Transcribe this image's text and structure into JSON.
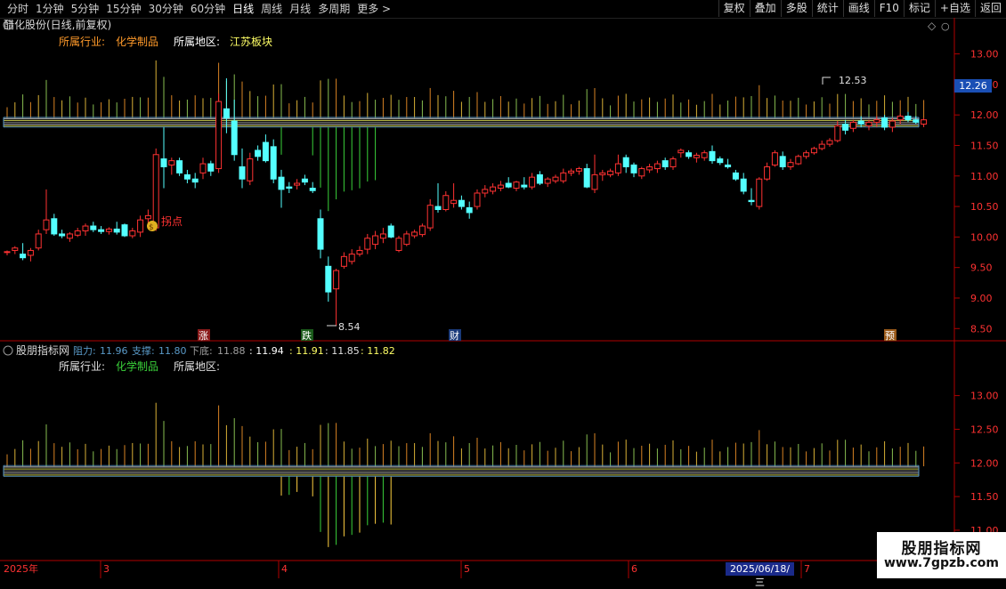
{
  "toolbar": {
    "periods": [
      "分时",
      "1分钟",
      "5分钟",
      "15分钟",
      "30分钟",
      "60分钟",
      "日线",
      "周线",
      "月线",
      "多周期",
      "更多"
    ],
    "active_period": "日线",
    "more_glyph": ">",
    "right_buttons": [
      "复权",
      "叠加",
      "多股",
      "统计",
      "画线",
      "F10",
      "标记",
      "+自选",
      "返回"
    ]
  },
  "main_panel": {
    "title": "醋化股份(日线,前复权)",
    "industry_label": "所属行业:",
    "industry_value": "化学制品",
    "region_label": "所属地区:",
    "region_value": "江苏板块",
    "pivot_label": "拐点",
    "high_label": "12.53",
    "low_label": "8.54",
    "current_price": "12.26",
    "event_markers": [
      "涨",
      "跌",
      "财",
      "预"
    ],
    "icons": [
      "dropdown-icon",
      "diamond-icon",
      "circle-icon"
    ]
  },
  "sub_panel": {
    "title": "股朋指标网",
    "resistance_label": "阻力:",
    "resistance_value": "11.96",
    "support_label": "支撑:",
    "support_value": "11.80",
    "bottom_label": "下底:",
    "bottom_value": "11.88",
    "v2": ": 11.94",
    "v3": ": 11.91",
    "v4": ": 11.85",
    "v5": ": 11.82",
    "industry_label": "所属行业:",
    "industry_value": "化学制品",
    "region_label": "所属地区:"
  },
  "x_axis": {
    "labels": [
      "2025年",
      "3",
      "4",
      "5",
      "6",
      "7"
    ],
    "highlight_date": "2025/06/18/三"
  },
  "watermark": {
    "line1": "股朋指标网",
    "line2": "www.7gpzb.com"
  },
  "colors": {
    "up": "#ff3232",
    "down": "#54ffff",
    "axis": "#b00000",
    "band": "#7aa0c0",
    "orange": "#ff9a2a",
    "green": "#3ad23a",
    "yellow": "#ffff66"
  },
  "chart_data": [
    {
      "type": "candlestick",
      "title": "醋化股份(日线,前复权)",
      "ylim": [
        8.3,
        13.3
      ],
      "yticks": [
        8.5,
        9.0,
        9.5,
        10.0,
        10.5,
        11.0,
        11.5,
        12.0,
        12.5,
        13.0
      ],
      "annotations": [
        {
          "text": "12.53",
          "value": 12.53
        },
        {
          "text": "8.54",
          "value": 8.54
        },
        {
          "text": "拐点"
        }
      ],
      "ohlc": [
        [
          9.75,
          9.78,
          9.7,
          9.76
        ],
        [
          9.78,
          9.85,
          9.72,
          9.82
        ],
        [
          9.72,
          9.9,
          9.62,
          9.66
        ],
        [
          9.7,
          9.82,
          9.6,
          9.78
        ],
        [
          9.82,
          10.12,
          9.78,
          10.05
        ],
        [
          10.12,
          10.78,
          10.05,
          10.28
        ],
        [
          10.3,
          10.38,
          10.02,
          10.05
        ],
        [
          10.05,
          10.12,
          9.98,
          10.02
        ],
        [
          9.98,
          10.08,
          9.92,
          10.05
        ],
        [
          10.03,
          10.15,
          10.0,
          10.1
        ],
        [
          10.1,
          10.22,
          10.02,
          10.18
        ],
        [
          10.18,
          10.25,
          10.08,
          10.12
        ],
        [
          10.12,
          10.18,
          10.05,
          10.09
        ],
        [
          10.09,
          10.16,
          10.04,
          10.13
        ],
        [
          10.13,
          10.25,
          10.04,
          10.08
        ],
        [
          10.2,
          10.22,
          10.0,
          10.02
        ],
        [
          10.02,
          10.15,
          9.98,
          10.1
        ],
        [
          10.08,
          10.35,
          10.0,
          10.28
        ],
        [
          10.3,
          10.45,
          10.22,
          10.35
        ],
        [
          10.15,
          11.45,
          10.1,
          11.35
        ],
        [
          11.28,
          11.8,
          10.8,
          11.15
        ],
        [
          11.18,
          11.3,
          11.02,
          11.25
        ],
        [
          11.25,
          11.3,
          11.0,
          11.05
        ],
        [
          11.02,
          11.1,
          10.88,
          10.95
        ],
        [
          10.95,
          11.05,
          10.8,
          10.9
        ],
        [
          11.05,
          11.3,
          10.95,
          11.2
        ],
        [
          11.2,
          11.25,
          11.0,
          11.08
        ],
        [
          11.12,
          12.35,
          11.05,
          12.22
        ],
        [
          12.1,
          12.6,
          11.7,
          11.95
        ],
        [
          11.9,
          12.25,
          11.25,
          11.35
        ],
        [
          11.15,
          11.45,
          10.8,
          10.95
        ],
        [
          10.92,
          11.38,
          10.85,
          11.28
        ],
        [
          11.42,
          11.5,
          11.25,
          11.32
        ],
        [
          11.55,
          11.68,
          11.22,
          11.25
        ],
        [
          11.48,
          11.6,
          10.88,
          10.95
        ],
        [
          10.98,
          11.1,
          10.48,
          10.78
        ],
        [
          10.82,
          10.9,
          10.72,
          10.8
        ],
        [
          10.85,
          10.95,
          10.78,
          10.88
        ],
        [
          10.95,
          11.02,
          10.85,
          10.9
        ],
        [
          10.8,
          10.9,
          10.72,
          10.76
        ],
        [
          10.3,
          10.45,
          9.65,
          9.8
        ],
        [
          9.52,
          9.68,
          8.94,
          9.1
        ],
        [
          9.15,
          9.48,
          8.54,
          9.45
        ],
        [
          9.52,
          9.75,
          9.48,
          9.68
        ],
        [
          9.6,
          9.8,
          9.55,
          9.72
        ],
        [
          9.72,
          9.85,
          9.68,
          9.78
        ],
        [
          9.8,
          10.05,
          9.72,
          9.98
        ],
        [
          9.88,
          10.1,
          9.8,
          10.02
        ],
        [
          9.98,
          10.15,
          9.9,
          10.05
        ],
        [
          10.18,
          10.22,
          9.98,
          10.0
        ],
        [
          9.78,
          10.02,
          9.75,
          9.98
        ],
        [
          9.88,
          10.1,
          9.85,
          10.05
        ],
        [
          10.02,
          10.12,
          9.98,
          10.08
        ],
        [
          10.04,
          10.22,
          10.0,
          10.18
        ],
        [
          10.15,
          10.62,
          10.1,
          10.52
        ],
        [
          10.5,
          10.88,
          10.4,
          10.45
        ],
        [
          10.45,
          10.75,
          10.42,
          10.68
        ],
        [
          10.55,
          10.88,
          10.48,
          10.6
        ],
        [
          10.6,
          10.68,
          10.45,
          10.5
        ],
        [
          10.48,
          10.58,
          10.3,
          10.4
        ],
        [
          10.5,
          10.78,
          10.45,
          10.72
        ],
        [
          10.72,
          10.85,
          10.65,
          10.78
        ],
        [
          10.75,
          10.88,
          10.7,
          10.82
        ],
        [
          10.8,
          10.92,
          10.75,
          10.85
        ],
        [
          10.88,
          10.98,
          10.8,
          10.82
        ],
        [
          10.8,
          10.92,
          10.75,
          10.9
        ],
        [
          10.85,
          10.98,
          10.78,
          10.82
        ],
        [
          10.82,
          11.05,
          10.78,
          10.98
        ],
        [
          11.02,
          11.08,
          10.85,
          10.88
        ],
        [
          10.88,
          10.98,
          10.82,
          10.95
        ],
        [
          10.92,
          11.02,
          10.88,
          10.98
        ],
        [
          10.92,
          11.12,
          10.88,
          11.05
        ],
        [
          11.05,
          11.12,
          11.0,
          11.08
        ],
        [
          11.08,
          11.15,
          11.02,
          11.12
        ],
        [
          11.12,
          11.2,
          10.8,
          10.82
        ],
        [
          10.78,
          11.35,
          10.72,
          11.02
        ],
        [
          11.02,
          11.1,
          10.92,
          11.05
        ],
        [
          11.02,
          11.12,
          10.98,
          11.08
        ],
        [
          11.05,
          11.35,
          11.0,
          11.2
        ],
        [
          11.3,
          11.35,
          11.05,
          11.15
        ],
        [
          11.18,
          11.22,
          10.98,
          11.05
        ],
        [
          11.0,
          11.15,
          10.95,
          11.12
        ],
        [
          11.1,
          11.2,
          11.05,
          11.15
        ],
        [
          11.12,
          11.25,
          11.05,
          11.2
        ],
        [
          11.25,
          11.3,
          11.1,
          11.15
        ],
        [
          11.15,
          11.32,
          11.1,
          11.28
        ],
        [
          11.38,
          11.45,
          11.3,
          11.42
        ],
        [
          11.38,
          11.42,
          11.28,
          11.32
        ],
        [
          11.3,
          11.38,
          11.22,
          11.34
        ],
        [
          11.3,
          11.42,
          11.25,
          11.38
        ],
        [
          11.4,
          11.5,
          11.2,
          11.25
        ],
        [
          11.28,
          11.32,
          11.18,
          11.22
        ],
        [
          11.18,
          11.28,
          11.12,
          11.15
        ],
        [
          11.05,
          11.1,
          10.92,
          10.95
        ],
        [
          10.95,
          11.05,
          10.7,
          10.75
        ],
        [
          10.6,
          10.8,
          10.52,
          10.58
        ],
        [
          10.5,
          10.98,
          10.45,
          10.95
        ],
        [
          10.95,
          11.22,
          10.92,
          11.15
        ],
        [
          11.18,
          11.42,
          11.15,
          11.38
        ],
        [
          11.32,
          11.4,
          11.1,
          11.15
        ],
        [
          11.15,
          11.28,
          11.1,
          11.22
        ],
        [
          11.2,
          11.35,
          11.18,
          11.32
        ],
        [
          11.32,
          11.42,
          11.28,
          11.38
        ],
        [
          11.38,
          11.48,
          11.35,
          11.45
        ],
        [
          11.45,
          11.58,
          11.42,
          11.52
        ],
        [
          11.52,
          11.62,
          11.48,
          11.58
        ],
        [
          11.58,
          11.9,
          11.55,
          11.82
        ],
        [
          11.85,
          11.92,
          11.68,
          11.75
        ],
        [
          11.78,
          11.92,
          11.72,
          11.88
        ],
        [
          11.9,
          11.98,
          11.8,
          11.85
        ],
        [
          11.82,
          11.92,
          11.75,
          11.88
        ],
        [
          11.88,
          11.98,
          11.8,
          11.92
        ],
        [
          11.95,
          12.0,
          11.75,
          11.8
        ],
        [
          11.8,
          11.95,
          11.72,
          11.9
        ],
        [
          11.92,
          12.02,
          11.85,
          11.98
        ],
        [
          11.98,
          12.05,
          11.88,
          11.92
        ],
        [
          11.92,
          11.98,
          11.85,
          11.88
        ],
        [
          11.85,
          11.95,
          11.8,
          11.92
        ]
      ]
    },
    {
      "type": "bar",
      "title": "股朋指标网",
      "ylim": [
        10.55,
        13.55
      ],
      "yticks": [
        11.0,
        11.5,
        12.0,
        12.5,
        13.0
      ],
      "levels": {
        "resistance": 11.96,
        "support": 11.8,
        "bottom": 11.88,
        "v2": 11.94,
        "v3": 11.91,
        "v4": 11.85,
        "v5": 11.82
      }
    }
  ]
}
